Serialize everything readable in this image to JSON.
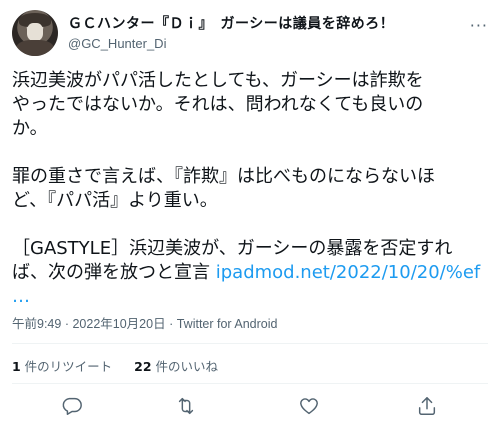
{
  "author": {
    "display_name": "ＧＣハンター『Ｄｉ』　ガーシーは議員を辞めろ！",
    "handle": "@GC_Hunter_Di",
    "more_label": "···"
  },
  "tweet": {
    "line1": "浜辺美波がパパ活したとしても、ガーシーは詐欺を",
    "line2": "やったではないか。それは、問われなくても良いの",
    "line3": "か。",
    "line4": "罪の重さで言えば、『詐欺』は比べものにならないほ",
    "line5": "ど、『パパ活』より重い。",
    "line6": "［GASTYLE］浜辺美波が、ガーシーの暴露を否定すれ",
    "line7_text": "ば、次の弾を放つと宣言 ",
    "line7_link": "ipadmod.net/2022/10/20/%ef",
    "line8_link": "…"
  },
  "meta": {
    "time": "午前9:49",
    "date": "2022年10月20日",
    "source": "Twitter for Android"
  },
  "stats": {
    "retweets_count": "1",
    "retweets_label": " 件のリツイート",
    "likes_count": "22",
    "likes_label": " 件のいいね"
  },
  "icons": [
    "reply-icon",
    "retweet-icon",
    "like-icon",
    "share-icon"
  ],
  "colors": {
    "link": "#1d9bf0",
    "muted": "#536471",
    "text": "#0f1419"
  }
}
